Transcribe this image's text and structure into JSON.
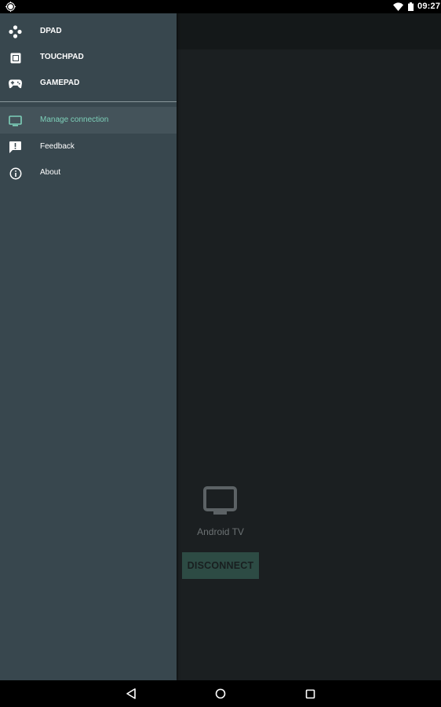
{
  "status_bar": {
    "time": "09:27",
    "left_icon": "location-icon",
    "right_icons": [
      "wifi-icon",
      "battery-icon"
    ]
  },
  "drawer": {
    "items": [
      {
        "label": "DPAD",
        "icon": "dpad-icon",
        "active": false
      },
      {
        "label": "TOUCHPAD",
        "icon": "touchpad-icon",
        "active": false
      },
      {
        "label": "GAMEPAD",
        "icon": "gamepad-icon",
        "active": false
      }
    ],
    "secondary_items": [
      {
        "label": "Manage connection",
        "icon": "tv-icon",
        "active": true
      },
      {
        "label": "Feedback",
        "icon": "feedback-icon",
        "active": false
      },
      {
        "label": "About",
        "icon": "info-icon",
        "active": false
      }
    ]
  },
  "content": {
    "device_icon": "tv-icon",
    "device_name": "Android TV",
    "disconnect_label": "DISCONNECT"
  },
  "nav_bar": {
    "buttons": [
      "back-icon",
      "home-icon",
      "recents-icon"
    ]
  },
  "colors": {
    "drawer_bg": "#38474e",
    "active_item_bg": "#44535a",
    "accent": "#7dd0b9",
    "content_bg": "#1b1f21",
    "disconnect_bg": "#2d4b44"
  }
}
